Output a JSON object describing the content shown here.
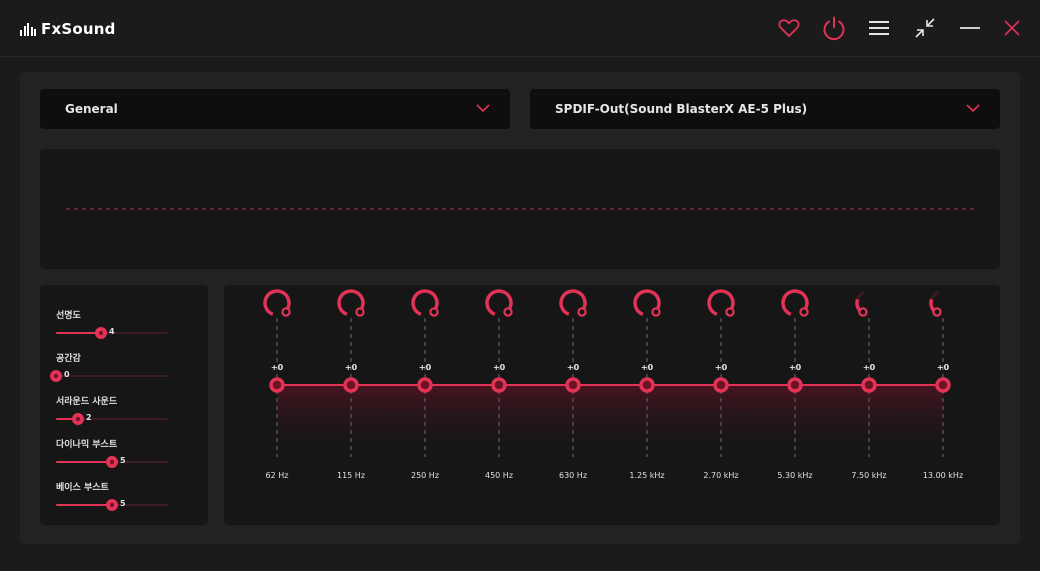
{
  "app": {
    "title": "FxSound",
    "accent_color": "#e23356",
    "icons": [
      "heart-icon",
      "power-icon",
      "menu-icon",
      "collapse-icon",
      "minimize-icon",
      "close-icon"
    ]
  },
  "preset_dropdown": {
    "selected": "General"
  },
  "output_dropdown": {
    "selected": "SPDIF-Out(Sound BlasterX AE-5 Plus)"
  },
  "effects": [
    {
      "label": "선명도",
      "value": "4",
      "level": 0.4
    },
    {
      "label": "공간감",
      "value": "0",
      "level": 0.0
    },
    {
      "label": "서라운드 사운드",
      "value": "2",
      "level": 0.2
    },
    {
      "label": "다이나믹 부스트",
      "value": "5",
      "level": 0.5
    },
    {
      "label": "베이스 부스트",
      "value": "5",
      "level": 0.5
    }
  ],
  "equalizer": {
    "bands": [
      {
        "gain": "+0",
        "frequency": "62 Hz",
        "knob_active": true
      },
      {
        "gain": "+0",
        "frequency": "115 Hz",
        "knob_active": true
      },
      {
        "gain": "+0",
        "frequency": "250 Hz",
        "knob_active": true
      },
      {
        "gain": "+0",
        "frequency": "450 Hz",
        "knob_active": true
      },
      {
        "gain": "+0",
        "frequency": "630 Hz",
        "knob_active": true
      },
      {
        "gain": "+0",
        "frequency": "1.25 kHz",
        "knob_active": true
      },
      {
        "gain": "+0",
        "frequency": "2.70 kHz",
        "knob_active": true
      },
      {
        "gain": "+0",
        "frequency": "5.30 kHz",
        "knob_active": true
      },
      {
        "gain": "+0",
        "frequency": "7.50 kHz",
        "knob_active": false
      },
      {
        "gain": "+0",
        "frequency": "13.00 kHz",
        "knob_active": false
      }
    ]
  }
}
